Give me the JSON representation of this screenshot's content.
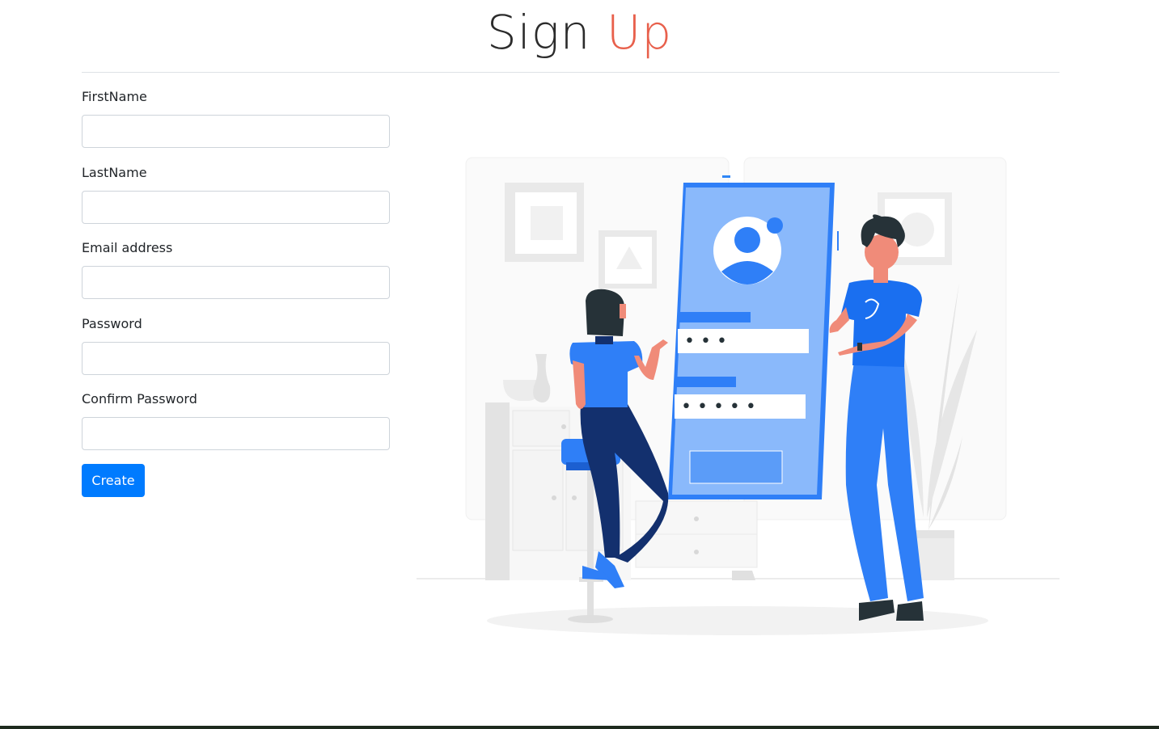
{
  "header": {
    "title_main": "Sign",
    "title_accent": "Up"
  },
  "form": {
    "fields": [
      {
        "label": "FirstName",
        "value": "",
        "placeholder": ""
      },
      {
        "label": "LastName",
        "value": "",
        "placeholder": ""
      },
      {
        "label": "Email address",
        "value": "",
        "placeholder": ""
      },
      {
        "label": "Password",
        "value": "",
        "placeholder": ""
      },
      {
        "label": "Confirm Password",
        "value": "",
        "placeholder": ""
      }
    ],
    "submit_label": "Create"
  },
  "illustration": {
    "password_mask_1": "•••",
    "password_mask_2": "•••••"
  },
  "colors": {
    "accent": "#e8604c",
    "primary": "#007bff"
  }
}
